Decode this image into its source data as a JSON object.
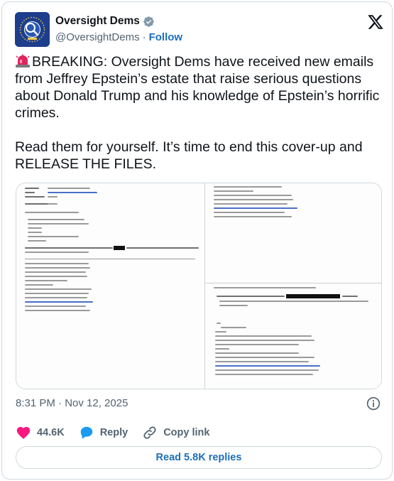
{
  "account": {
    "display_name": "Oversight Dems",
    "handle": "@OversightDems",
    "separator": "·",
    "follow_label": "Follow",
    "verified": true,
    "avatar_icon": "oversight-seal-logo"
  },
  "tweet": {
    "paragraph1": "BREAKING: Oversight Dems have received new emails from Jeffrey Epstein’s estate that raise serious questions about Donald Trump and his knowledge of Epstein’s horrific crimes.",
    "paragraph2": "Read them for yourself. It’s time to end this cover-up and RELEASE THE FILES.",
    "leading_icon": "rotating-light-emoji"
  },
  "media": {
    "type": "document-screenshot"
  },
  "footer": {
    "timestamp": "8:31 PM · Nov 12, 2025",
    "likes": "44.6K",
    "reply_label": "Reply",
    "copy_link_label": "Copy link",
    "read_replies_label": "Read 5.8K replies"
  },
  "colors": {
    "accent": "#1d6fb8",
    "like": "#f91880",
    "reply_icon": "#1d9bf0",
    "muted": "#536471",
    "text": "#0f1419",
    "border": "#cfd9de"
  }
}
